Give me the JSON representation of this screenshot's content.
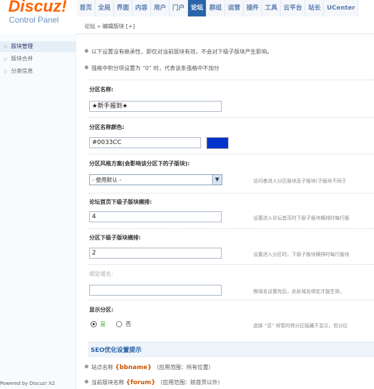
{
  "header": {
    "logo": "Discuz!",
    "logo_sub": "Control Panel",
    "nav": [
      "首页",
      "全局",
      "界面",
      "内容",
      "用户",
      "门户",
      "论坛",
      "群组",
      "运营",
      "插件",
      "工具",
      "云平台",
      "站长",
      "UCenter"
    ]
  },
  "sidebar": {
    "items": [
      "版块管理",
      "版块合并",
      "分类信息"
    ],
    "powered": "Powered by Discuz! X2"
  },
  "main": {
    "breadcrumb": "论坛 » 编辑版块  [+]",
    "tips": [
      "以下设置没有继承性，即仅对当前版块有效，不会对下级子版块产生影响。",
      "强格中积分项设置为 “0” 时，代表该条强格中不加分"
    ],
    "fields": {
      "name_label": "分区名称:",
      "name_value": "★新手报到★",
      "color_label": "分区名称颜色:",
      "color_value": "#0033CC",
      "color_swatch": "#0033cc",
      "style_label": "分区风格方案(会影响该分区下的子版块):",
      "style_value": "- 使用默认 -",
      "style_hint": "访问者进入分区版块及子版块(子版块不同于",
      "home_cols_label": "论坛首页下级子版块横排:",
      "home_cols_value": "4",
      "home_cols_hint": "设置进入论坛首页时下级子版块横排时每行版",
      "sub_cols_label": "分区下级子版块横排:",
      "sub_cols_value": "2",
      "sub_cols_hint": "设置进入分区时，下级子版块横排时每行版块",
      "domain_label": "绑定域名:",
      "domain_value": "",
      "domain_hint": "根域名设置完后，此处域名绑定才能生效。",
      "display_label": "显示分区:",
      "yes_label": "是",
      "no_label": "否",
      "display_hint": "选择 “否” 将暂时将分区隐藏不显示，但分区"
    },
    "seo": {
      "title": "SEO优化设置提示",
      "items": [
        {
          "prefix": "站点名称",
          "tag": "{bbname}",
          "suffix": "（应用范围：所有位置）"
        },
        {
          "prefix": "当前版块名称",
          "tag": "{forum}",
          "suffix": "（应用范围：除首页以外）"
        }
      ]
    }
  }
}
